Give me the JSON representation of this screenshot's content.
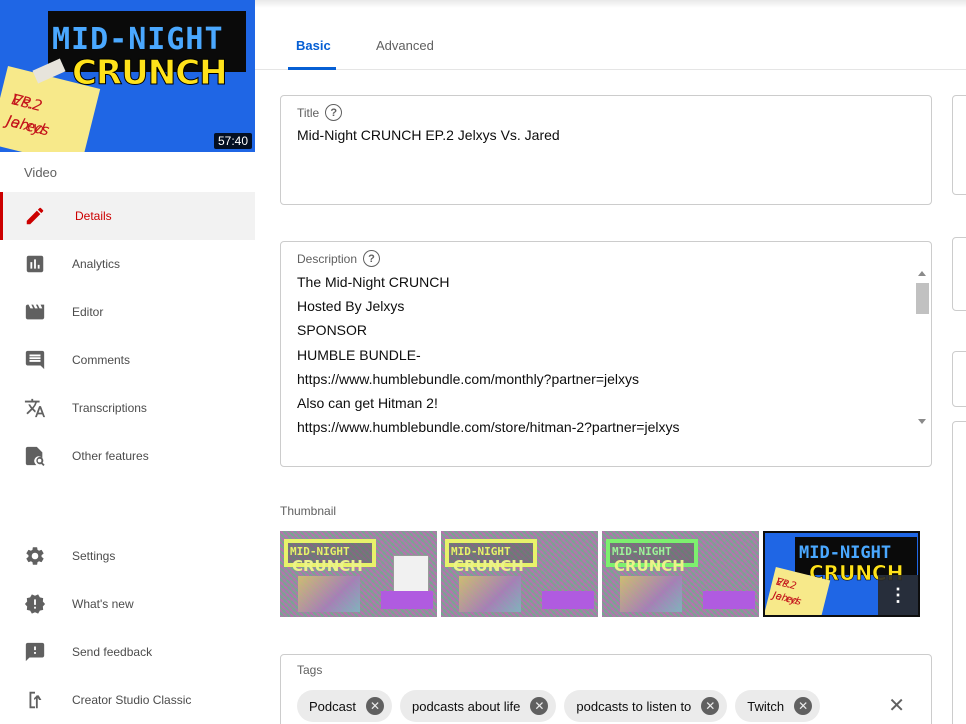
{
  "video": {
    "duration": "57:40",
    "thumbnail_title_top": "MID-NIGHT",
    "thumbnail_title_bottom": "CRUNCH",
    "thumbnail_note_line1": "EP.2 Jelxys",
    "thumbnail_note_line2": "Vs. Jared"
  },
  "sidebar": {
    "section_label": "Video",
    "items": [
      {
        "label": "Details",
        "icon": "pencil-icon",
        "active": true
      },
      {
        "label": "Analytics",
        "icon": "analytics-icon"
      },
      {
        "label": "Editor",
        "icon": "film-icon"
      },
      {
        "label": "Comments",
        "icon": "comment-icon"
      },
      {
        "label": "Transcriptions",
        "icon": "translate-icon"
      },
      {
        "label": "Other features",
        "icon": "search-page-icon"
      }
    ],
    "footer_items": [
      {
        "label": "Settings",
        "icon": "gear-icon"
      },
      {
        "label": "What's new",
        "icon": "alert-icon"
      },
      {
        "label": "Send feedback",
        "icon": "feedback-icon"
      },
      {
        "label": "Creator Studio Classic",
        "icon": "classic-icon"
      }
    ]
  },
  "tabs": [
    {
      "label": "Basic",
      "active": true
    },
    {
      "label": "Advanced",
      "active": false
    }
  ],
  "title_field": {
    "label": "Title",
    "value": "Mid-Night CRUNCH EP.2 Jelxys Vs. Jared"
  },
  "description_field": {
    "label": "Description",
    "lines": [
      "The Mid-Night CRUNCH",
      "Hosted By Jelxys",
      "SPONSOR",
      "HUMBLE BUNDLE-",
      "https://www.humblebundle.com/monthly?partner=jelxys",
      "Also can get Hitman 2!",
      "https://www.humblebundle.com/store/hitman-2?partner=jelxys"
    ]
  },
  "thumbnail_section": {
    "label": "Thumbnail",
    "options": [
      {
        "banner": "MID-NIGHT",
        "sub": "CRUNCH",
        "selected": false
      },
      {
        "banner": "MID-NIGHT",
        "sub": "CRUNCH",
        "selected": false
      },
      {
        "banner": "MID-NIGHT",
        "sub": "CRUNCH",
        "selected": false
      },
      {
        "banner": "MID-NIGHT",
        "sub": "CRUNCH",
        "selected": true
      }
    ],
    "more_icon": "more-vert-icon"
  },
  "tags_field": {
    "label": "Tags",
    "chips": [
      "Podcast",
      "podcasts about life",
      "podcasts to listen to",
      "Twitch"
    ],
    "clear_icon": "close-icon"
  },
  "colors": {
    "accent": "#065fd4",
    "active_red": "#cc0000"
  }
}
